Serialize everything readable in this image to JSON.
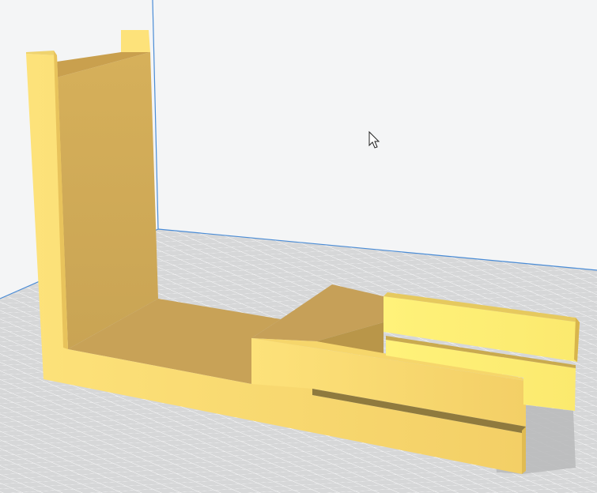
{
  "viewport": {
    "background": "#f4f5f6",
    "build_plate_color": "#d6d7d8",
    "grid_line_color": "#f8f8f9",
    "volume_edge_color": "#4a8cd6",
    "model_color": "#f2cf63",
    "cursor_icon": "arrow-pointer-icon"
  }
}
